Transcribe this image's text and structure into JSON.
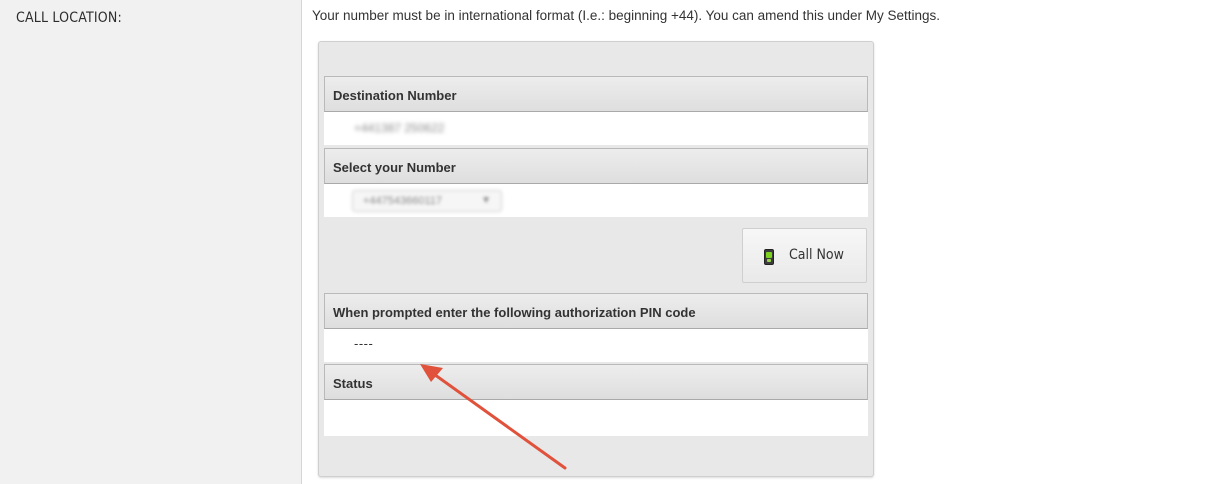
{
  "form": {
    "call_location_label": "CALL LOCATION:",
    "help_text": "Your number must be in international format (I.e.: beginning +44). You can amend this under My Settings."
  },
  "panel": {
    "destination_header": "Destination Number",
    "destination_value": "+441387 250622",
    "select_header": "Select your Number",
    "select_value": "+447543660117",
    "call_button_label": "Call Now",
    "pin_header": "When prompted enter the following authorization PIN code",
    "pin_value": "----",
    "status_header": "Status",
    "status_value": ""
  },
  "icons": {
    "call_button_icon": "mobile-phone-icon",
    "select_arrow_icon": "dropdown-arrow-icon",
    "annotation": "red-arrow-icon"
  },
  "colors": {
    "panel_bg": "#e8e8e8",
    "header_bg": "#e2e2e2",
    "annotation_arrow": "#e0523b"
  }
}
